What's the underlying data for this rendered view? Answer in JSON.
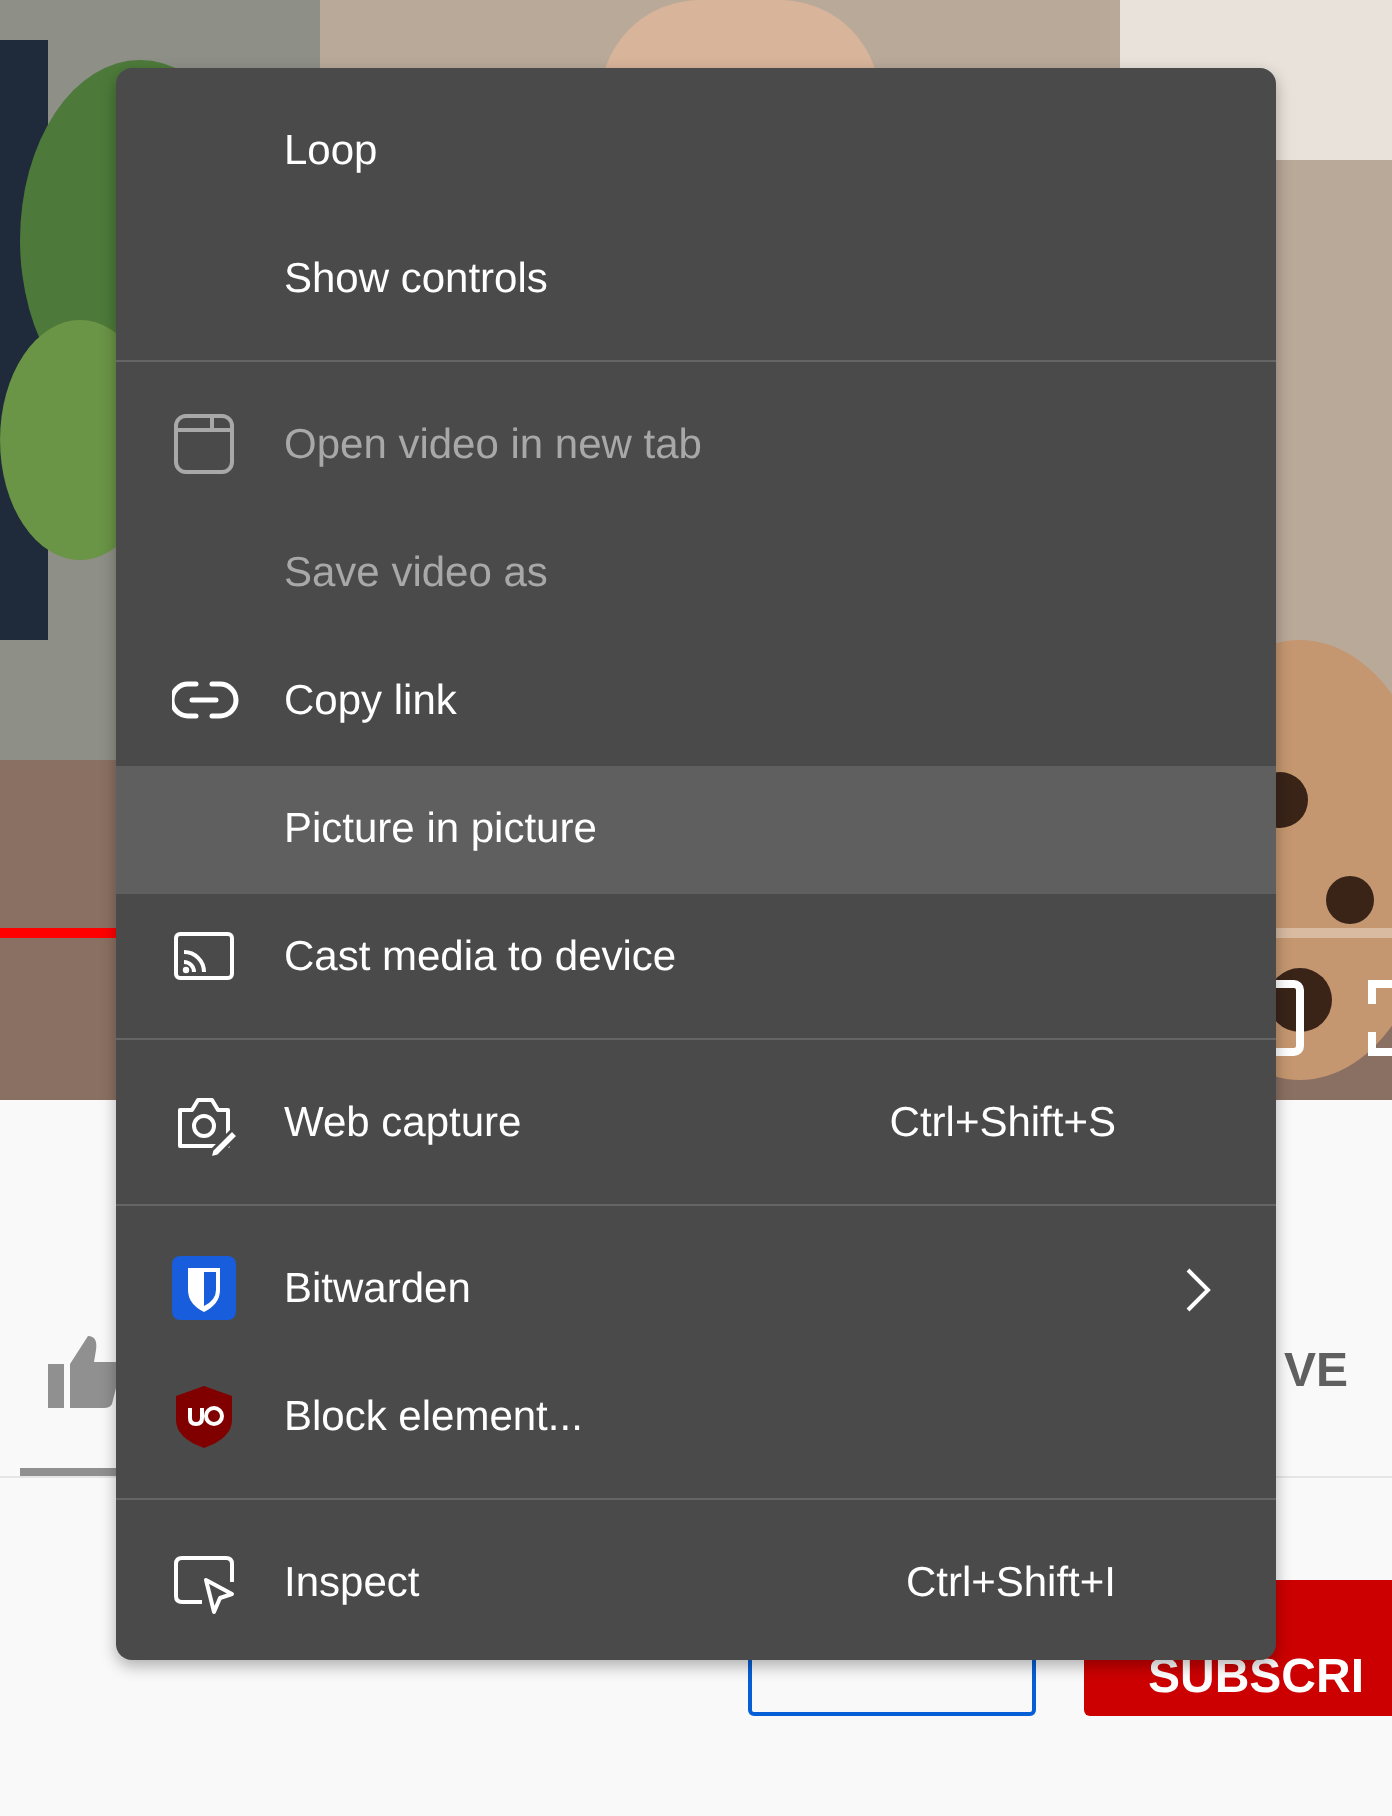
{
  "video": {
    "kind": "picture",
    "progress": {
      "level": 0.09
    }
  },
  "actions": {
    "save_label": "VE",
    "subscribe": "SUBSCRI"
  },
  "context_menu": {
    "sections": [
      {
        "items": [
          {
            "label": "Loop",
            "kind": "plain",
            "disabled": false,
            "selected": false
          },
          {
            "label": "Show controls",
            "kind": "plain",
            "disabled": false,
            "selected": false
          }
        ]
      },
      {
        "items": [
          {
            "label": "Open video in new tab",
            "kind": "tab",
            "disabled": true,
            "selected": false
          },
          {
            "label": "Save video as",
            "kind": "plain",
            "disabled": true,
            "selected": false
          },
          {
            "label": "Copy link",
            "kind": "link",
            "disabled": false,
            "selected": false
          },
          {
            "label": "Picture in picture",
            "kind": "plain",
            "disabled": false,
            "selected": true
          },
          {
            "label": "Cast media to device",
            "kind": "cast",
            "disabled": false,
            "selected": false
          }
        ]
      },
      {
        "items": [
          {
            "label": "Web capture",
            "kind": "capture",
            "disabled": false,
            "selected": false,
            "shortcut": "Ctrl+Shift+S"
          }
        ]
      },
      {
        "items": [
          {
            "label": "Bitwarden",
            "kind": "vault",
            "disabled": false,
            "selected": false,
            "submenu": true
          },
          {
            "label": "Block element...",
            "kind": "blocker",
            "disabled": false,
            "selected": false
          }
        ]
      },
      {
        "items": [
          {
            "label": "Inspect",
            "kind": "inspect",
            "disabled": false,
            "selected": false,
            "shortcut": "Ctrl+Shift+I"
          }
        ]
      }
    ]
  }
}
